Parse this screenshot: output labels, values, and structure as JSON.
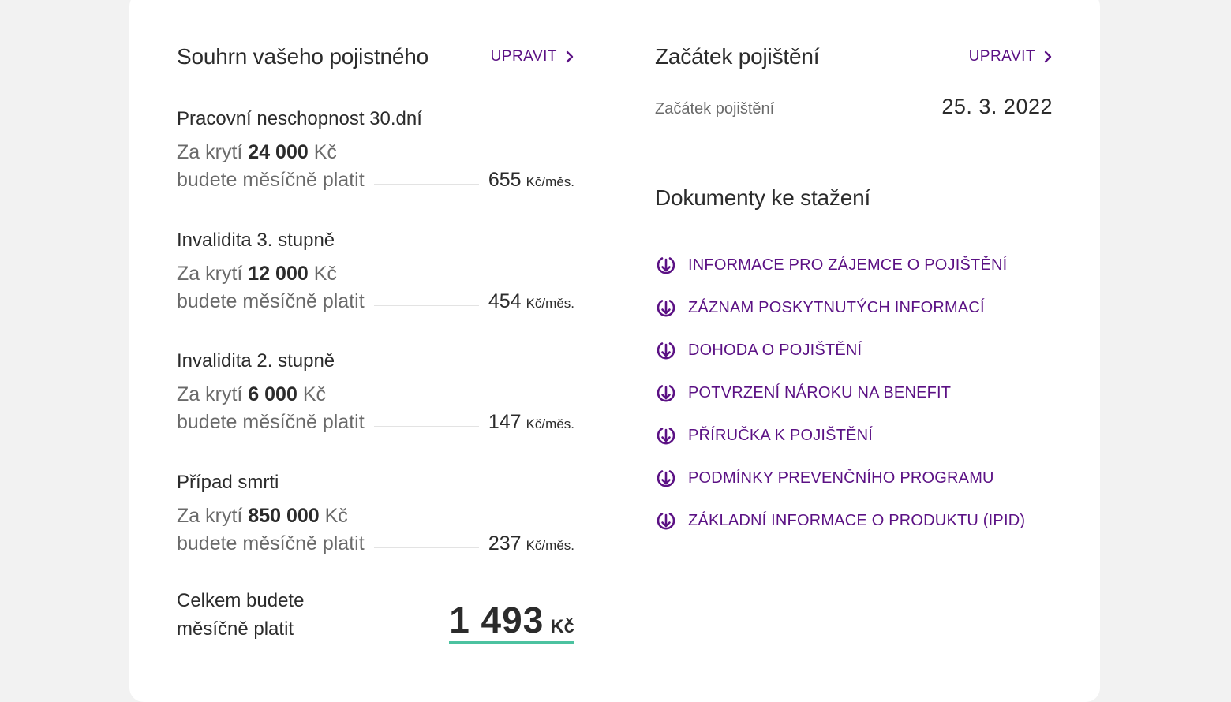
{
  "colors": {
    "accent": "#5b1184",
    "total_underline": "#4cc2a0"
  },
  "summary": {
    "title": "Souhrn vašeho pojistného",
    "edit_label": "UPRAVIT",
    "items": [
      {
        "title": "Pracovní neschopnost 30.dní",
        "coverage_prefix": "Za krytí",
        "coverage_amount": "24 000",
        "coverage_currency": "Kč",
        "pay_label": "budete měsíčně platit",
        "amount": "655",
        "unit": "Kč/měs."
      },
      {
        "title": "Invalidita 3. stupně",
        "coverage_prefix": "Za krytí",
        "coverage_amount": "12 000",
        "coverage_currency": "Kč",
        "pay_label": "budete měsíčně platit",
        "amount": "454",
        "unit": "Kč/měs."
      },
      {
        "title": "Invalidita 2. stupně",
        "coverage_prefix": "Za krytí",
        "coverage_amount": "6 000",
        "coverage_currency": "Kč",
        "pay_label": "budete měsíčně platit",
        "amount": "147",
        "unit": "Kč/měs."
      },
      {
        "title": "Případ smrti",
        "coverage_prefix": "Za krytí",
        "coverage_amount": "850 000",
        "coverage_currency": "Kč",
        "pay_label": "budete měsíčně platit",
        "amount": "237",
        "unit": "Kč/měs."
      }
    ],
    "total_label_line1": "Celkem budete",
    "total_label_line2": "měsíčně platit",
    "total_amount": "1 493",
    "total_unit": "Kč"
  },
  "start": {
    "title": "Začátek pojištění",
    "edit_label": "UPRAVIT",
    "label": "Začátek pojištění",
    "date": "25. 3. 2022"
  },
  "documents": {
    "title": "Dokumenty ke stažení",
    "icon": "download-icon",
    "items": [
      "INFORMACE PRO ZÁJEMCE O POJIŠTĚNÍ",
      "ZÁZNAM POSKYTNUTÝCH INFORMACÍ",
      "DOHODA O POJIŠTĚNÍ",
      "POTVRZENÍ NÁROKU NA BENEFIT",
      "PŘÍRUČKA K POJIŠTĚNÍ",
      "PODMÍNKY PREVENČNÍHO PROGRAMU",
      "ZÁKLADNÍ INFORMACE O PRODUKTU (IPID)"
    ]
  }
}
